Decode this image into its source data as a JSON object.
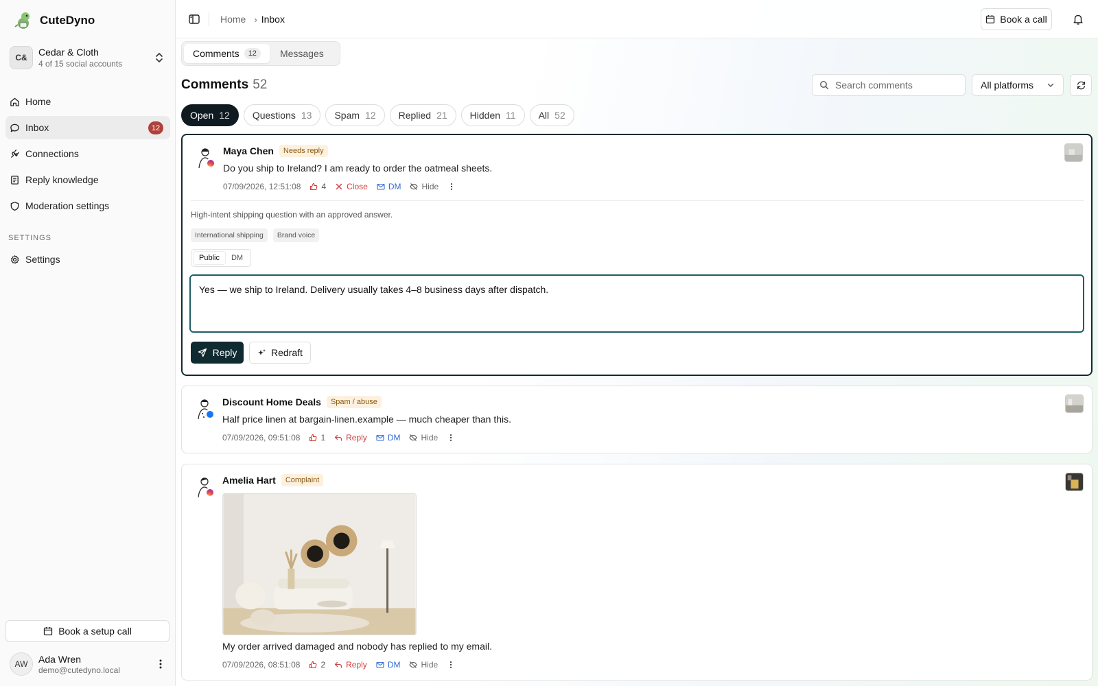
{
  "brand": {
    "name": "CuteDyno"
  },
  "account": {
    "initials": "C&",
    "name": "Cedar & Cloth",
    "subtitle": "4 of 15 social accounts"
  },
  "nav": [
    {
      "label": "Home",
      "icon": "home-icon"
    },
    {
      "label": "Inbox",
      "icon": "chat-icon",
      "badge": "12"
    },
    {
      "label": "Connections",
      "icon": "plug-icon"
    },
    {
      "label": "Reply knowledge",
      "icon": "book-icon"
    },
    {
      "label": "Moderation settings",
      "icon": "shield-icon"
    }
  ],
  "settings": {
    "heading": "SETTINGS",
    "item": "Settings"
  },
  "sidebar_footer": {
    "setup_call": "Book a setup call"
  },
  "user": {
    "initials": "AW",
    "name": "Ada Wren",
    "email": "demo@cutedyno.local"
  },
  "breadcrumb": {
    "home": "Home",
    "current": "Inbox"
  },
  "topbar": {
    "book_call": "Book a call"
  },
  "tabs": [
    {
      "label": "Comments",
      "count": "12"
    },
    {
      "label": "Messages"
    }
  ],
  "page": {
    "title": "Comments",
    "count": "52"
  },
  "search": {
    "placeholder": "Search comments"
  },
  "platform_filter": {
    "selected": "All platforms"
  },
  "filters": [
    {
      "label": "Open",
      "count": "12"
    },
    {
      "label": "Questions",
      "count": "13"
    },
    {
      "label": "Spam",
      "count": "12"
    },
    {
      "label": "Replied",
      "count": "21"
    },
    {
      "label": "Hidden",
      "count": "11"
    },
    {
      "label": "All",
      "count": "52"
    }
  ],
  "comments": [
    {
      "author": "Maya Chen",
      "tag": "Needs reply",
      "platform": "instagram",
      "text": "Do you ship to Ireland? I am ready to order the oatmeal sheets.",
      "time": "07/09/2026, 12:51:08",
      "likes": "4",
      "actions": {
        "primary": "Close",
        "dm": "DM",
        "hide": "Hide"
      },
      "ai_note": "High-intent shipping question with an approved answer.",
      "chips": [
        "International shipping",
        "Brand voice"
      ],
      "mode": {
        "public": "Public",
        "dm": "DM"
      },
      "draft": "Yes — we ship to Ireland. Delivery usually takes 4–8 business days after dispatch.",
      "buttons": {
        "reply": "Reply",
        "redraft": "Redraft"
      }
    },
    {
      "author": "Discount Home Deals",
      "tag": "Spam / abuse",
      "platform": "facebook",
      "text": "Half price linen at bargain-linen.example — much cheaper than this.",
      "time": "07/09/2026, 09:51:08",
      "likes": "1",
      "actions": {
        "primary": "Reply",
        "dm": "DM",
        "hide": "Hide"
      }
    },
    {
      "author": "Amelia Hart",
      "tag": "Complaint",
      "platform": "instagram",
      "text": "My order arrived damaged and nobody has replied to my email.",
      "time": "07/09/2026, 08:51:08",
      "likes": "2",
      "actions": {
        "primary": "Reply",
        "dm": "DM",
        "hide": "Hide"
      }
    }
  ],
  "colors": {
    "accent": "#0f2a30",
    "badge": "#b0403a",
    "danger": "#d23b3b",
    "link": "#2f6ad8",
    "tag_bg": "#fdf1de"
  }
}
